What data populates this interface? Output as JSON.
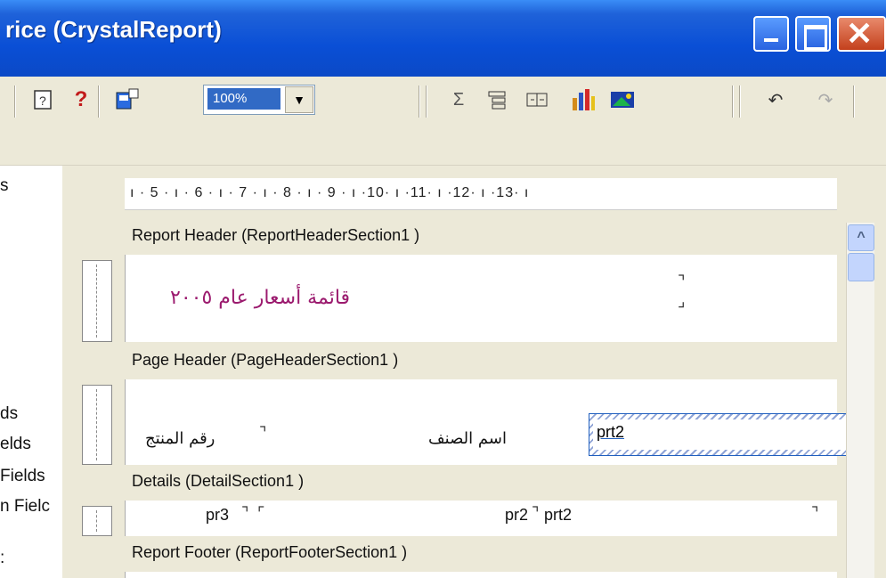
{
  "window": {
    "title": "rice (CrystalReport)",
    "buttons": {
      "minimize": "minimize",
      "maximize": "maximize",
      "close": "✕"
    }
  },
  "toolbar": {
    "zoom_value": "100%",
    "icons": [
      "help-book-icon",
      "help-question-icon",
      "field-explorer-icon",
      "sum-icon",
      "group-tree-icon",
      "insert-group-icon",
      "chart-icon",
      "image-icon",
      "undo-icon",
      "redo-icon"
    ]
  },
  "left_panel": {
    "items": [
      "s",
      "ds",
      "elds",
      "Fields",
      "n Fielc",
      ":"
    ]
  },
  "ruler": {
    "text": "ı · 5 · ı · 6 · ı · 7 · ı · 8 · ı · 9 · ı ·10· ı ·11· ı ·12· ı ·13· ı"
  },
  "sections": {
    "report_header": {
      "label": "Report Header  (ReportHeaderSection1 )",
      "title_text": "قائمة أسعار عام ٢٠٠٥"
    },
    "page_header": {
      "label": "Page Header  (PageHeaderSection1 )",
      "col_product_no": "رقم المنتج",
      "col_item_name": "اسم الصنف",
      "selected_field": "prt2"
    },
    "details": {
      "label": "Details  (DetailSection1 )",
      "field_a": "pr3",
      "field_b": "pr2",
      "field_c": "prt2"
    },
    "report_footer": {
      "label": "Report Footer  (ReportFooterSection1 )"
    }
  },
  "scrollbar": {
    "up_arrow": "^"
  }
}
